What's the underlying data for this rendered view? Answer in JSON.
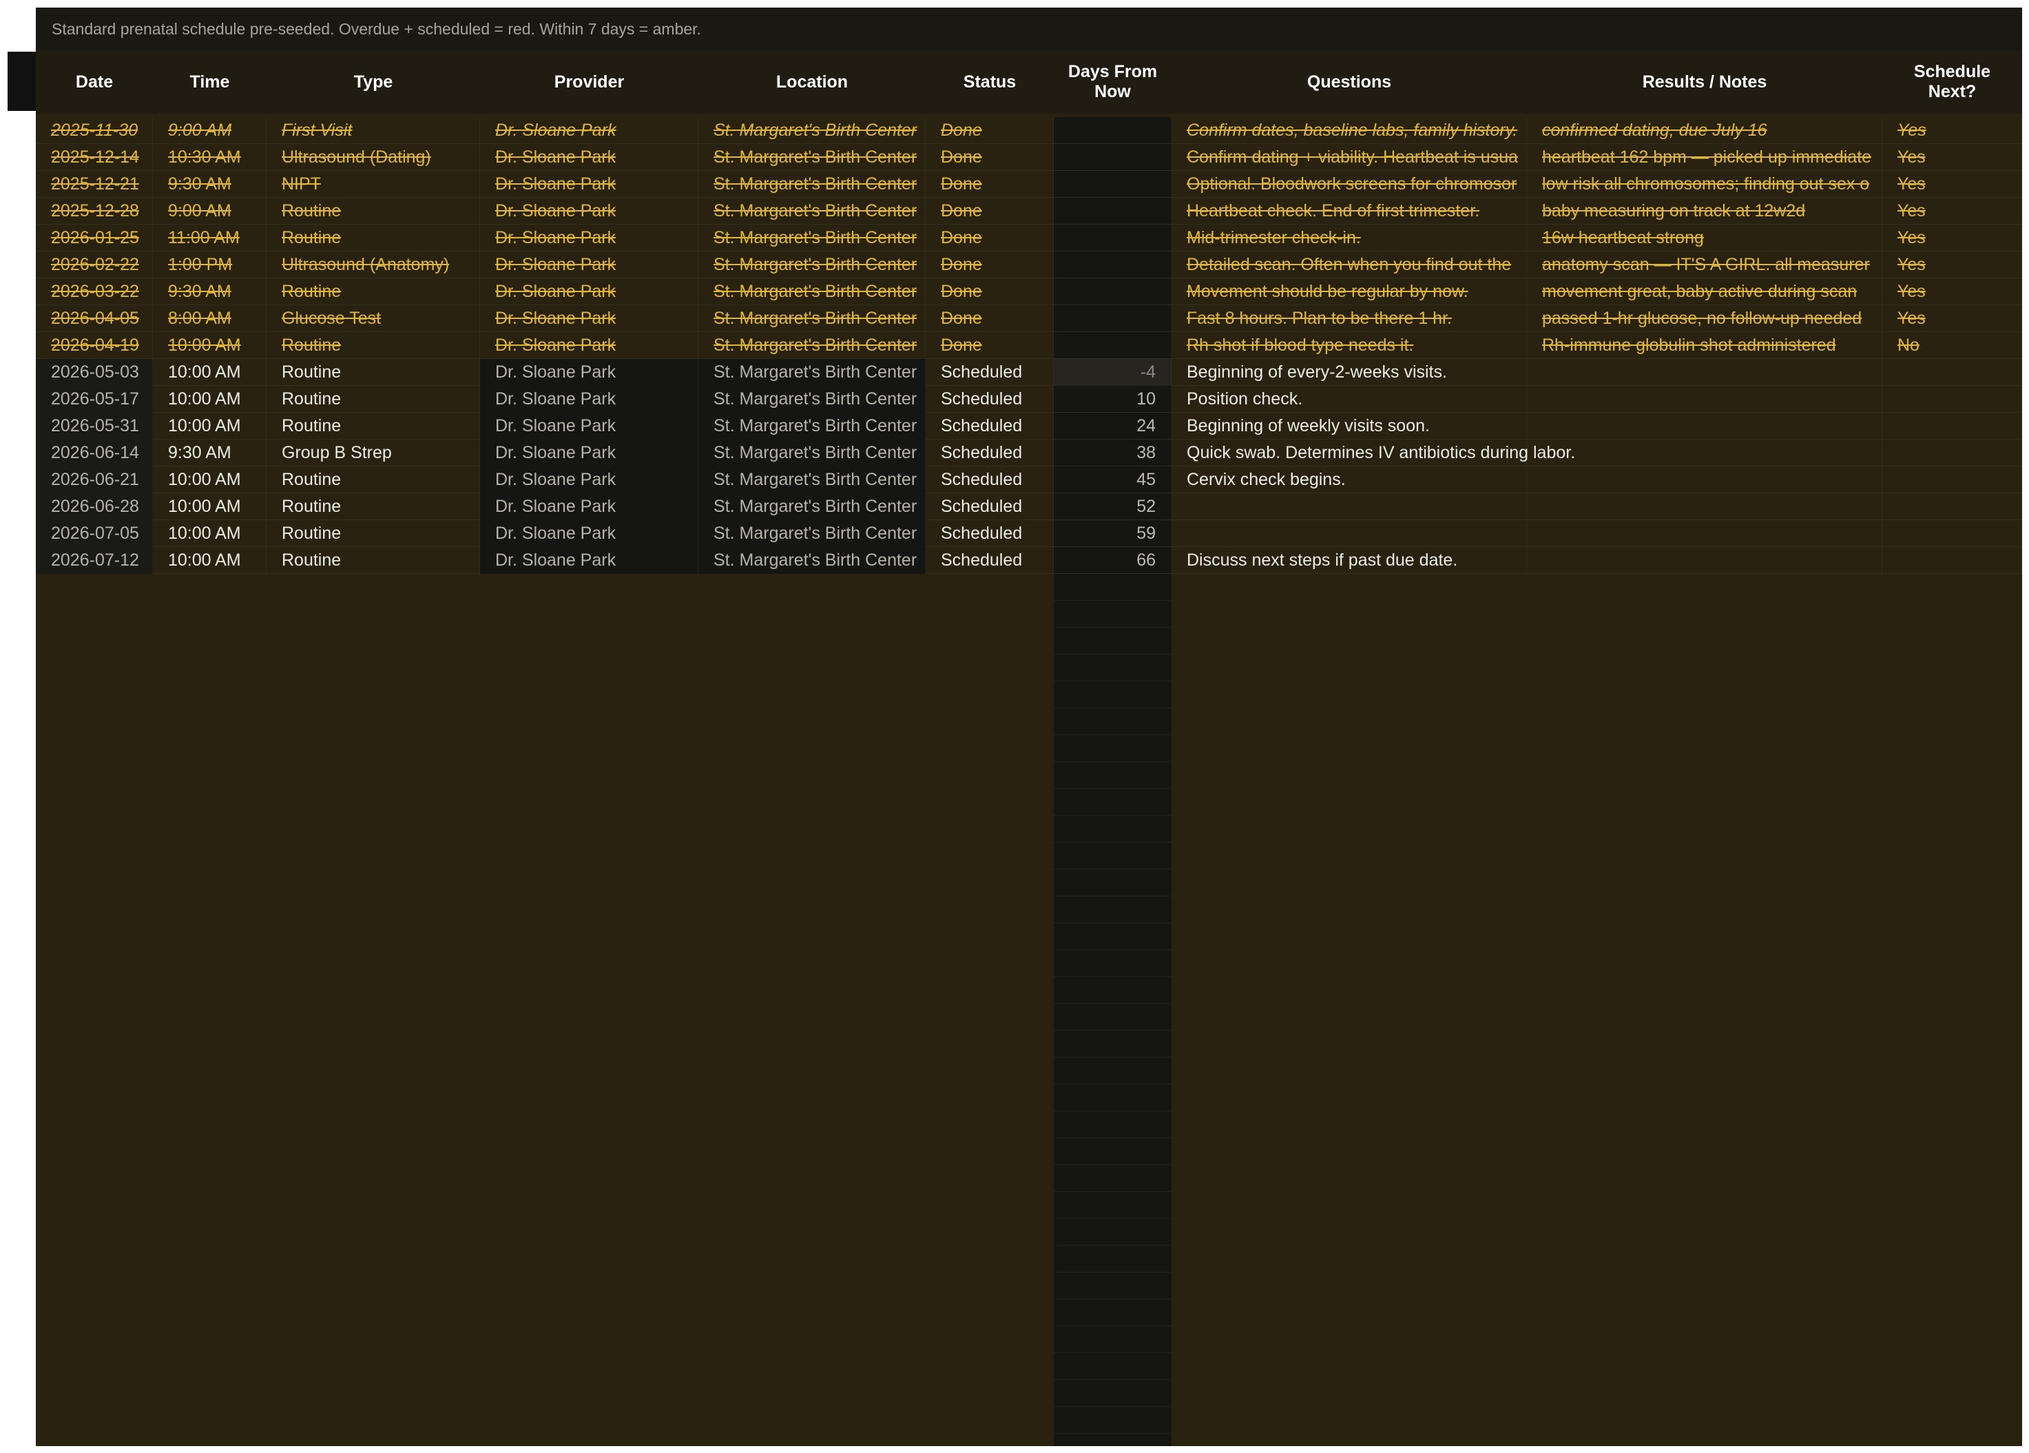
{
  "note": "Standard prenatal schedule pre-seeded. Overdue + scheduled = red. Within 7 days = amber.",
  "colors": {
    "done_text": "#e0b73e",
    "scheduled_text": "#ecebe6",
    "sheet_background": "#2a2210",
    "header_background": "#201c12"
  },
  "columns": [
    {
      "key": "date",
      "label": "Date"
    },
    {
      "key": "time",
      "label": "Time"
    },
    {
      "key": "type",
      "label": "Type"
    },
    {
      "key": "provider",
      "label": "Provider"
    },
    {
      "key": "location",
      "label": "Location"
    },
    {
      "key": "status",
      "label": "Status"
    },
    {
      "key": "days",
      "label": "Days From\nNow"
    },
    {
      "key": "questions",
      "label": "Questions"
    },
    {
      "key": "results",
      "label": "Results / Notes"
    },
    {
      "key": "next",
      "label": "Schedule\nNext?"
    }
  ],
  "rows": [
    {
      "date": "2025-11-30",
      "time": "9:00 AM",
      "type": "First Visit",
      "provider": "Dr. Sloane Park",
      "location": "St. Margaret's Birth Center",
      "status": "Done",
      "days": "",
      "questions": "Confirm dates, baseline labs, family history.",
      "results": "confirmed dating, due July 16",
      "next": "Yes"
    },
    {
      "date": "2025-12-14",
      "time": "10:30 AM",
      "type": "Ultrasound (Dating)",
      "provider": "Dr. Sloane Park",
      "location": "St. Margaret's Birth Center",
      "status": "Done",
      "days": "",
      "questions": "Confirm dating + viability. Heartbeat is usua",
      "results": "heartbeat 162 bpm — picked up immediate",
      "next": "Yes"
    },
    {
      "date": "2025-12-21",
      "time": "9:30 AM",
      "type": "NIPT",
      "provider": "Dr. Sloane Park",
      "location": "St. Margaret's Birth Center",
      "status": "Done",
      "days": "",
      "questions": "Optional. Bloodwork screens for chromosor",
      "results": "low risk all chromosomes; finding out sex o",
      "next": "Yes"
    },
    {
      "date": "2025-12-28",
      "time": "9:00 AM",
      "type": "Routine",
      "provider": "Dr. Sloane Park",
      "location": "St. Margaret's Birth Center",
      "status": "Done",
      "days": "",
      "questions": "Heartbeat check. End of first trimester.",
      "results": "baby measuring on track at 12w2d",
      "next": "Yes"
    },
    {
      "date": "2026-01-25",
      "time": "11:00 AM",
      "type": "Routine",
      "provider": "Dr. Sloane Park",
      "location": "St. Margaret's Birth Center",
      "status": "Done",
      "days": "",
      "questions": "Mid-trimester check-in.",
      "results": "16w heartbeat strong",
      "next": "Yes"
    },
    {
      "date": "2026-02-22",
      "time": "1:00 PM",
      "type": "Ultrasound (Anatomy)",
      "provider": "Dr. Sloane Park",
      "location": "St. Margaret's Birth Center",
      "status": "Done",
      "days": "",
      "questions": "Detailed scan. Often when you find out the",
      "results": "anatomy scan — IT'S A GIRL. all measurer",
      "next": "Yes"
    },
    {
      "date": "2026-03-22",
      "time": "9:30 AM",
      "type": "Routine",
      "provider": "Dr. Sloane Park",
      "location": "St. Margaret's Birth Center",
      "status": "Done",
      "days": "",
      "questions": "Movement should be regular by now.",
      "results": "movement great, baby active during scan",
      "next": "Yes"
    },
    {
      "date": "2026-04-05",
      "time": "8:00 AM",
      "type": "Glucose Test",
      "provider": "Dr. Sloane Park",
      "location": "St. Margaret's Birth Center",
      "status": "Done",
      "days": "",
      "questions": "Fast 8 hours. Plan to be there 1 hr.",
      "results": "passed 1-hr glucose, no follow-up needed",
      "next": "Yes"
    },
    {
      "date": "2026-04-19",
      "time": "10:00 AM",
      "type": "Routine",
      "provider": "Dr. Sloane Park",
      "location": "St. Margaret's Birth Center",
      "status": "Done",
      "days": "",
      "questions": "Rh shot if blood type needs it.",
      "results": "Rh-immune globulin shot administered",
      "next": "No"
    },
    {
      "date": "2026-05-03",
      "time": "10:00 AM",
      "type": "Routine",
      "provider": "Dr. Sloane Park",
      "location": "St. Margaret's Birth Center",
      "status": "Scheduled",
      "days": "-4",
      "questions": "Beginning of every-2-weeks visits.",
      "results": "",
      "next": ""
    },
    {
      "date": "2026-05-17",
      "time": "10:00 AM",
      "type": "Routine",
      "provider": "Dr. Sloane Park",
      "location": "St. Margaret's Birth Center",
      "status": "Scheduled",
      "days": "10",
      "questions": "Position check.",
      "results": "",
      "next": ""
    },
    {
      "date": "2026-05-31",
      "time": "10:00 AM",
      "type": "Routine",
      "provider": "Dr. Sloane Park",
      "location": "St. Margaret's Birth Center",
      "status": "Scheduled",
      "days": "24",
      "questions": "Beginning of weekly visits soon.",
      "results": "",
      "next": ""
    },
    {
      "date": "2026-06-14",
      "time": "9:30 AM",
      "type": "Group B Strep",
      "provider": "Dr. Sloane Park",
      "location": "St. Margaret's Birth Center",
      "status": "Scheduled",
      "days": "38",
      "questions": "Quick swab. Determines IV antibiotics during labor.",
      "results": "",
      "next": ""
    },
    {
      "date": "2026-06-21",
      "time": "10:00 AM",
      "type": "Routine",
      "provider": "Dr. Sloane Park",
      "location": "St. Margaret's Birth Center",
      "status": "Scheduled",
      "days": "45",
      "questions": "Cervix check begins.",
      "results": "",
      "next": ""
    },
    {
      "date": "2026-06-28",
      "time": "10:00 AM",
      "type": "Routine",
      "provider": "Dr. Sloane Park",
      "location": "St. Margaret's Birth Center",
      "status": "Scheduled",
      "days": "52",
      "questions": "",
      "results": "",
      "next": ""
    },
    {
      "date": "2026-07-05",
      "time": "10:00 AM",
      "type": "Routine",
      "provider": "Dr. Sloane Park",
      "location": "St. Margaret's Birth Center",
      "status": "Scheduled",
      "days": "59",
      "questions": "",
      "results": "",
      "next": ""
    },
    {
      "date": "2026-07-12",
      "time": "10:00 AM",
      "type": "Routine",
      "provider": "Dr. Sloane Park",
      "location": "St. Margaret's Birth Center",
      "status": "Scheduled",
      "days": "66",
      "questions": "Discuss next steps if past due date.",
      "results": "",
      "next": ""
    }
  ]
}
